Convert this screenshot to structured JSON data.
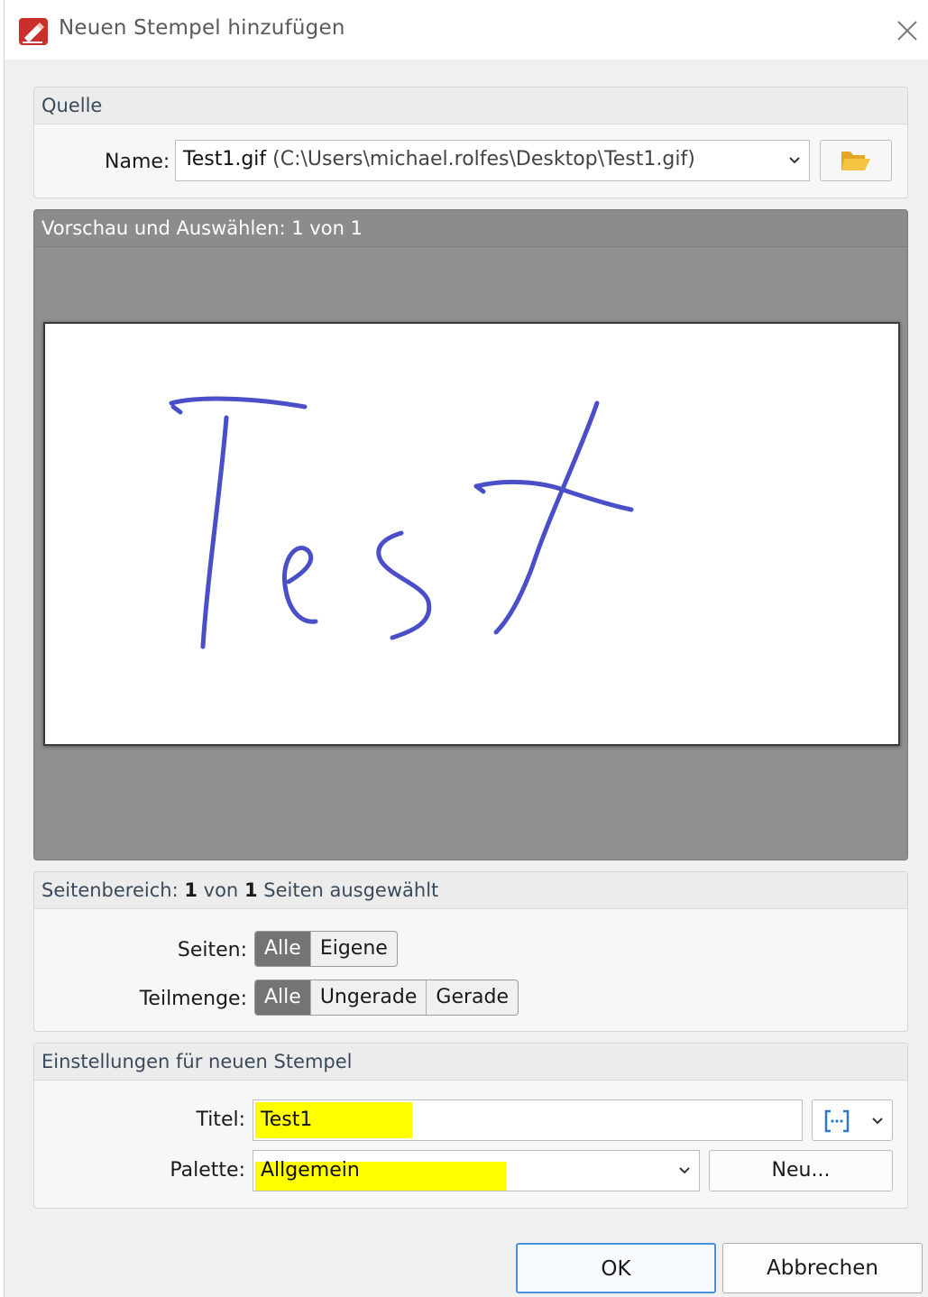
{
  "window": {
    "title": "Neuen Stempel hinzufügen",
    "icons": {
      "app": "pdf-stamp-logo-icon",
      "close": "close-icon"
    }
  },
  "source": {
    "header": "Quelle",
    "name_label": "Name:",
    "file_name": "Test1.gif",
    "file_path": "(C:\\Users\\michael.rolfes\\Desktop\\Test1.gif)",
    "icons": {
      "dropdown": "chevron-down-icon",
      "browse": "folder-open-icon"
    }
  },
  "preview": {
    "header": "Vorschau und Auswählen: 1 von 1",
    "image_description": "handwritten-signature",
    "ink_color": "#4b4fc7"
  },
  "page_range": {
    "header_prefix": "Seitenbereich:",
    "header_n1": "1",
    "header_mid": "von",
    "header_n2": "1",
    "header_suffix": "Seiten ausgewählt",
    "pages_label": "Seiten:",
    "pages_options": [
      "Alle",
      "Eigene"
    ],
    "pages_selected": "Alle",
    "subset_label": "Teilmenge:",
    "subset_options": [
      "Alle",
      "Ungerade",
      "Gerade"
    ],
    "subset_selected": "Alle"
  },
  "settings": {
    "header": "Einstellungen für neuen Stempel",
    "title_label": "Titel:",
    "title_value": "Test1",
    "palette_label": "Palette:",
    "palette_value": "Allgemein",
    "new_button": "Neu...",
    "highlight_color": "#ffff00",
    "icons": {
      "macro": "insert-macro-icon",
      "dropdown": "chevron-down-icon"
    }
  },
  "footer": {
    "ok": "OK",
    "cancel": "Abbrechen"
  }
}
